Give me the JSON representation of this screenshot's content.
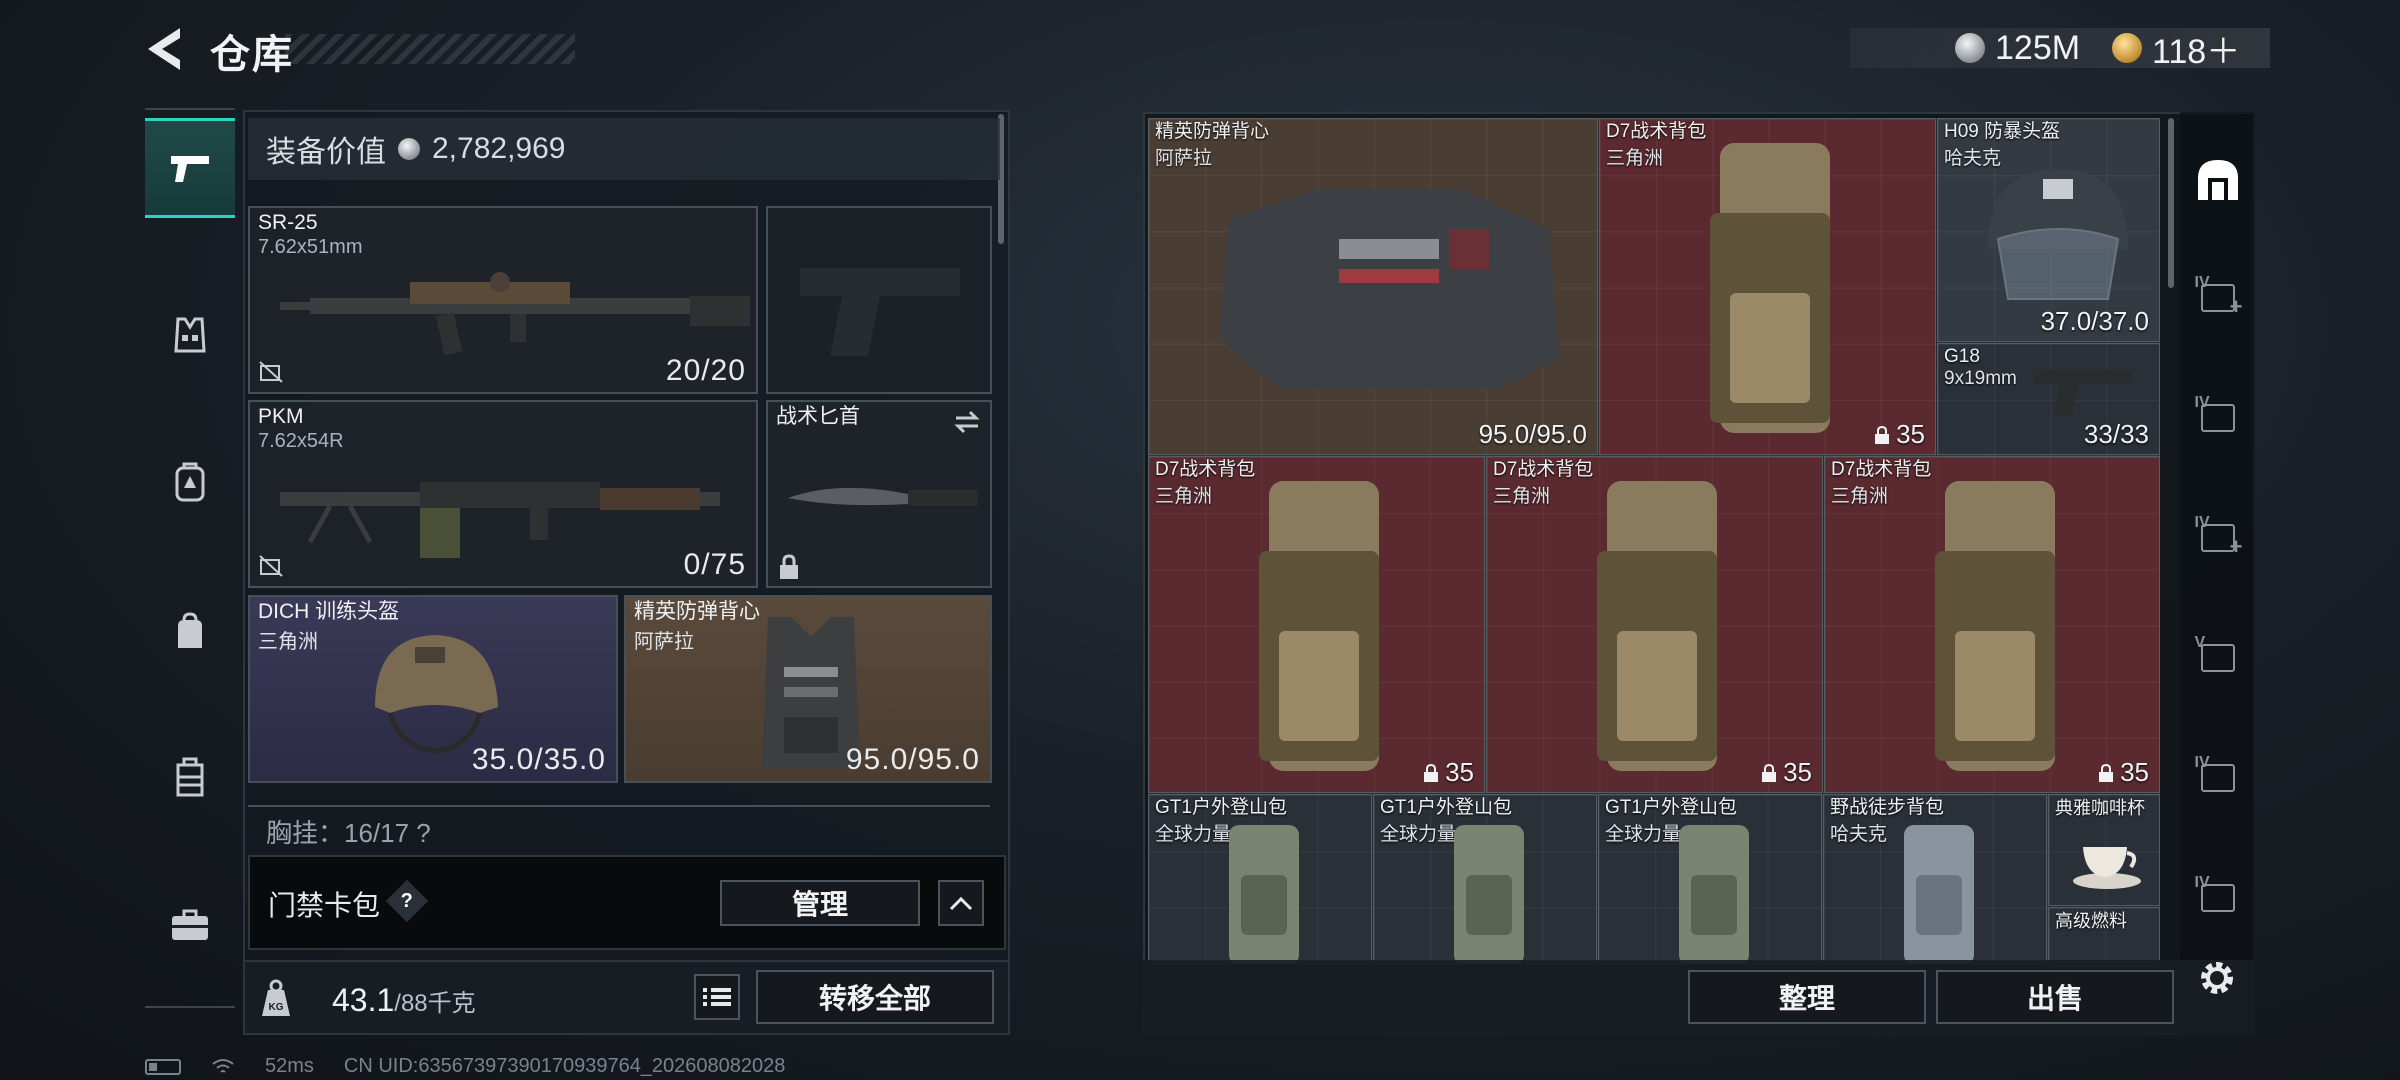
{
  "header": {
    "title": "仓库",
    "currency_silver": "125M",
    "currency_gold": "118＋"
  },
  "rail": {
    "items": [
      {
        "name": "weapons",
        "icon": "pistol-icon"
      },
      {
        "name": "armor",
        "icon": "vest-icon"
      },
      {
        "name": "backpack",
        "icon": "backpack-icon"
      },
      {
        "name": "bag",
        "icon": "bag-icon"
      },
      {
        "name": "rig",
        "icon": "rig-icon"
      },
      {
        "name": "case",
        "icon": "briefcase-icon"
      }
    ]
  },
  "equipment": {
    "value_label": "装备价值",
    "value": "2,782,969",
    "primary": {
      "name": "SR-25",
      "caliber": "7.62x51mm",
      "ammo": "20/20"
    },
    "secondary": {
      "name": "PKM",
      "caliber": "7.62x54R",
      "ammo": "0/75"
    },
    "melee": {
      "name": "战术匕首"
    },
    "helmet": {
      "name": "DICH 训练头盔",
      "brand": "三角洲",
      "durability": "35.0/35.0"
    },
    "vest": {
      "name": "精英防弹背心",
      "brand": "阿萨拉",
      "durability": "95.0/95.0"
    },
    "chest_row": "胸挂：16/17 ?"
  },
  "keycard": {
    "label": "门禁卡包",
    "help": "?",
    "manage": "管理"
  },
  "capacity": {
    "current": "43.1",
    "max": "/88千克",
    "transfer_all": "转移全部"
  },
  "status": {
    "ping": "52ms",
    "uid": "CN UID:63567397390170939764_202608082028"
  },
  "stash": {
    "items": [
      {
        "name": "精英防弹背心",
        "brand": "阿萨拉",
        "value": "95.0/95.0",
        "color": "tan"
      },
      {
        "name": "D7战术背包",
        "brand": "三角洲",
        "value": "35",
        "color": "red"
      },
      {
        "name": "H09 防暴头盔",
        "brand": "哈夫克",
        "value": "37.0/37.0",
        "color": "gray"
      },
      {
        "name": "G18",
        "brand": "9x19mm",
        "value": "33/33",
        "color": "dark"
      },
      {
        "name": "D7战术背包",
        "brand": "三角洲",
        "value": "35",
        "color": "red"
      },
      {
        "name": "D7战术背包",
        "brand": "三角洲",
        "value": "35",
        "color": "red"
      },
      {
        "name": "D7战术背包",
        "brand": "三角洲",
        "value": "35",
        "color": "red"
      },
      {
        "name": "GT1户外登山包",
        "brand": "全球力量",
        "color": "dark"
      },
      {
        "name": "GT1户外登山包",
        "brand": "全球力量",
        "color": "dark"
      },
      {
        "name": "GT1户外登山包",
        "brand": "全球力量",
        "color": "dark"
      },
      {
        "name": "野战徒步背包",
        "brand": "哈夫克",
        "color": "dark"
      },
      {
        "name": "典雅咖啡杯",
        "color": "dark"
      },
      {
        "name": "高级燃料",
        "color": "dark"
      }
    ],
    "sort": "整理",
    "sell": "出售"
  },
  "side_tabs": [
    "IV",
    "IV",
    "IV",
    "V",
    "IV",
    "IV"
  ],
  "colors": {
    "accent": "#2bd4c0",
    "red_item": "#5a2a30",
    "tan_item": "#4a3e34"
  }
}
